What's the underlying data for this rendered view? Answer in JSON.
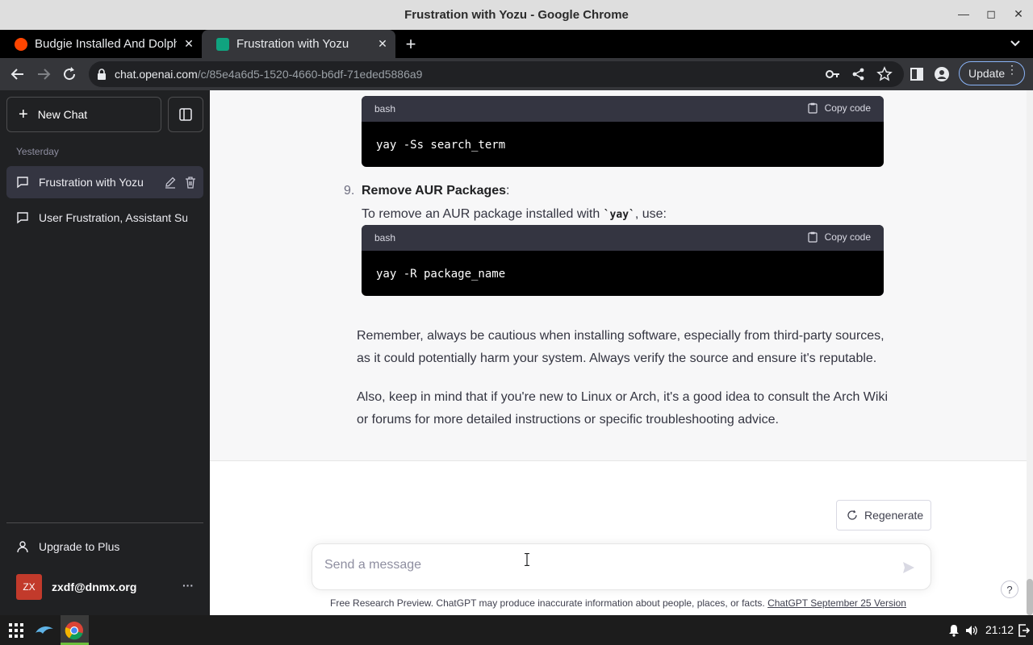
{
  "window": {
    "title": "Frustration with Yozu - Google Chrome"
  },
  "tabs": [
    {
      "label": "Budgie Installed And Dolphin",
      "favicon_color": "#ff4500",
      "active": false
    },
    {
      "label": "Frustration with Yozu",
      "favicon_color": "#10a37f",
      "active": true
    }
  ],
  "toolbar": {
    "url_host": "chat.openai.com",
    "url_path": "/c/85e4a6d5-1520-4660-b6df-71eded5886a9",
    "update_label": "Update"
  },
  "sidebar": {
    "new_chat_label": "New Chat",
    "section_label": "Yesterday",
    "conversations": [
      {
        "label": "Frustration with Yozu",
        "active": true
      },
      {
        "label": "User Frustration, Assistant Support",
        "active": false
      }
    ],
    "upgrade_label": "Upgrade to Plus",
    "user": {
      "initials": "ZX",
      "email": "zxdf@dnmx.org",
      "more": "···"
    }
  },
  "chat": {
    "code_blocks": [
      {
        "lang": "bash",
        "copy_label": "Copy code",
        "code": "yay -Ss search_term"
      },
      {
        "lang": "bash",
        "copy_label": "Copy code",
        "code": "yay -R package_name"
      }
    ],
    "list_item": {
      "number": "9.",
      "title": "Remove AUR Packages",
      "suffix": ":",
      "text_before": "To remove an AUR package installed with ",
      "inline_code": "`yay`",
      "text_after": ", use:"
    },
    "paragraphs": [
      "Remember, always be cautious when installing software, especially from third-party sources, as it could potentially harm your system. Always verify the source and ensure it's reputable.",
      "Also, keep in mind that if you're new to Linux or Arch, it's a good idea to consult the Arch Wiki or forums for more detailed instructions or specific troubleshooting advice."
    ],
    "regenerate_label": "Regenerate",
    "input_placeholder": "Send a message",
    "footer_text": "Free Research Preview. ChatGPT may produce inaccurate information about people, places, or facts. ",
    "footer_link": "ChatGPT September 25 Version",
    "help_label": "?"
  },
  "taskbar": {
    "clock": "21:12"
  }
}
